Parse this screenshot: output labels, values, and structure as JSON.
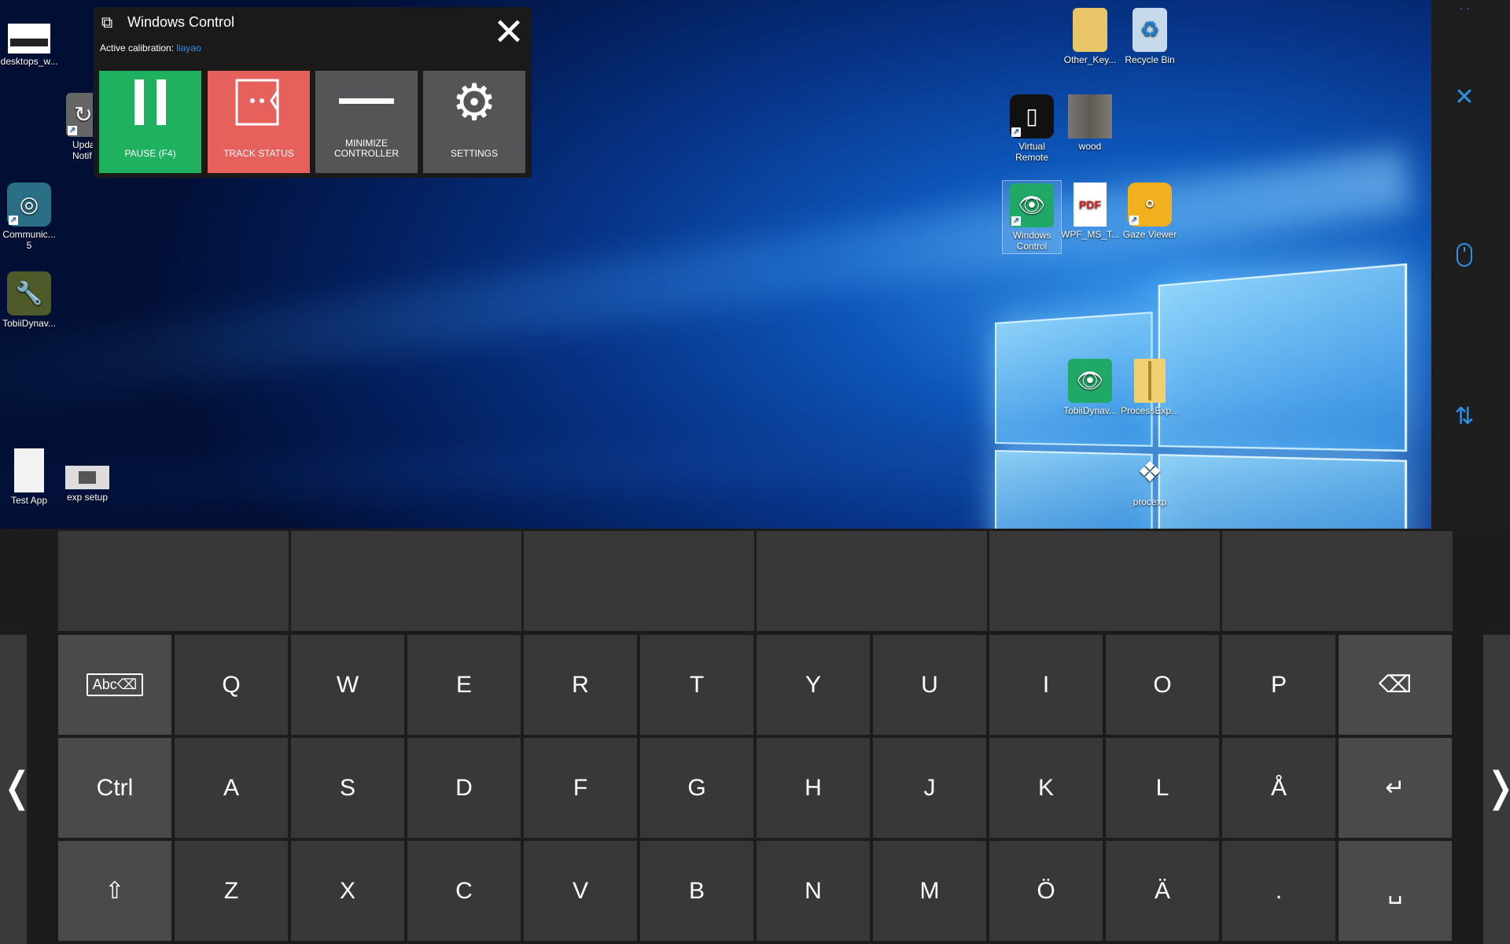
{
  "desktop": {
    "icons_left": [
      {
        "label": "desktops_w...",
        "icon": "screenshot-thumbnail-icon"
      },
      {
        "label": "Upda\nNotif",
        "icon": "update-notifier-icon"
      },
      {
        "label": "Communic...\n5",
        "icon": "communicator-5-icon"
      },
      {
        "label": "TobiiDynav...",
        "icon": "wrench-app-icon"
      },
      {
        "label": "Test App",
        "icon": "document-file-icon"
      },
      {
        "label": "exp setup",
        "icon": "photo-thumbnail-icon"
      }
    ],
    "icons_right": [
      {
        "label": "Other_Key...",
        "icon": "folder-icon"
      },
      {
        "label": "Recycle Bin",
        "icon": "recycle-bin-icon"
      },
      {
        "label": "Virtual\nRemote",
        "icon": "remote-control-icon"
      },
      {
        "label": "wood",
        "icon": "wood-texture-icon"
      },
      {
        "label": "Windows\nControl",
        "icon": "windows-control-eye-icon"
      },
      {
        "label": "WPF_MS_T...",
        "icon": "pdf-file-icon"
      },
      {
        "label": "Gaze Viewer",
        "icon": "gaze-viewer-icon"
      },
      {
        "label": "TobiiDynav...",
        "icon": "windows-control-eye-icon"
      },
      {
        "label": "ProcessExp...",
        "icon": "zip-folder-icon"
      },
      {
        "label": "procexp",
        "icon": "process-explorer-icon"
      }
    ]
  },
  "windows_control": {
    "title": "Windows Control",
    "calibration_label": "Active calibration:",
    "calibration_user": "liayao",
    "buttons": [
      {
        "label": "PAUSE (F4)",
        "color": "#1fb060"
      },
      {
        "label": "TRACK STATUS",
        "color": "#e6605c"
      },
      {
        "label": "MINIMIZE\nCONTROLLER",
        "color": "#555558"
      },
      {
        "label": "SETTINGS",
        "color": "#555558"
      }
    ]
  },
  "right_strip": {
    "icons": [
      "close-icon",
      "mouse-icon",
      "swap-arrows-icon"
    ],
    "accent": "#2f8ee6"
  },
  "keyboard": {
    "suggestions": [
      "",
      "",
      "",
      "",
      "",
      ""
    ],
    "row1": [
      "Abc⌫",
      "Q",
      "W",
      "E",
      "R",
      "T",
      "Y",
      "U",
      "I",
      "O",
      "P",
      "⌫"
    ],
    "row2": [
      "Ctrl",
      "A",
      "S",
      "D",
      "F",
      "G",
      "H",
      "J",
      "K",
      "L",
      "Å",
      "↵"
    ],
    "row3": [
      "⇧",
      "Z",
      "X",
      "C",
      "V",
      "B",
      "N",
      "M",
      "Ö",
      "Ä",
      ".",
      "␣"
    ],
    "nav_left": "❬",
    "nav_right": "❭"
  }
}
